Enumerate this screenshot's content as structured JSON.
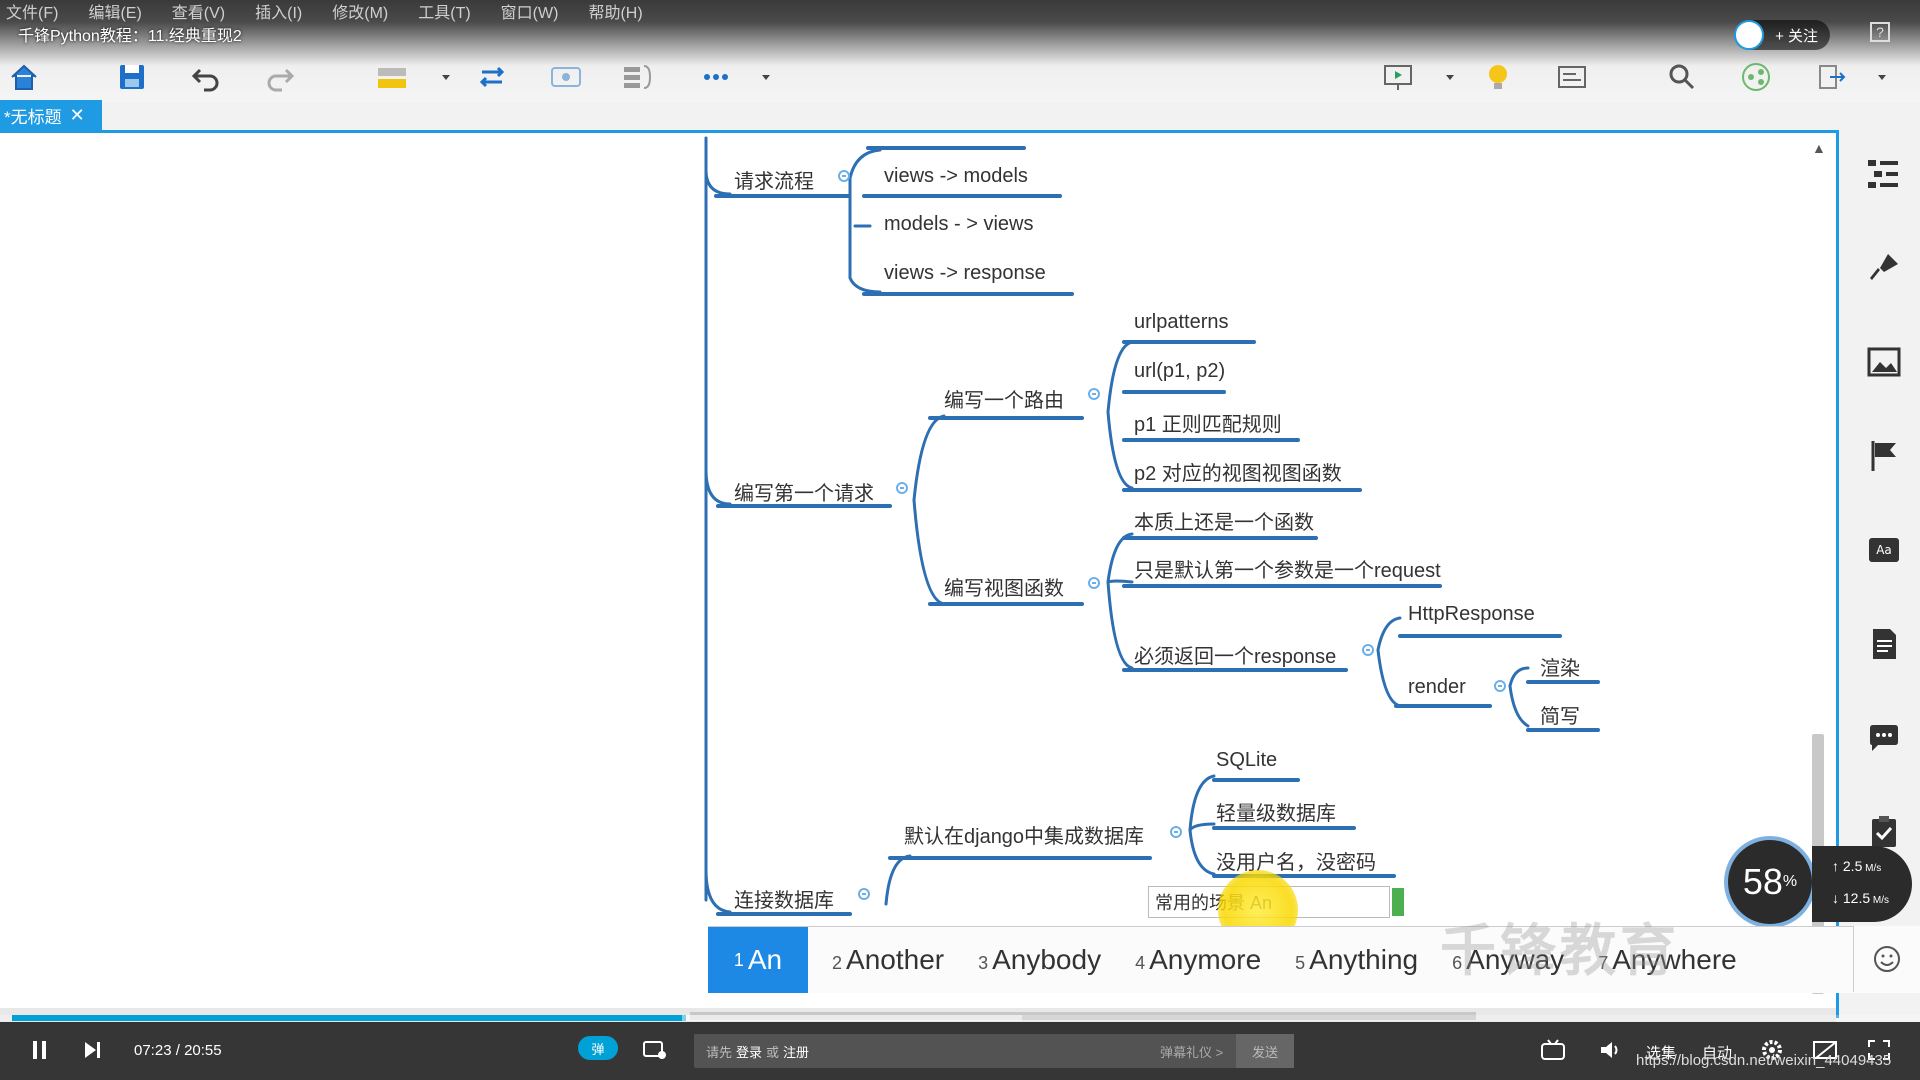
{
  "video": {
    "title": "千锋Python教程：11.经典重现2",
    "follow_label": "+ 关注",
    "current_time": "07:23",
    "separator": "/",
    "duration": "20:55",
    "progress": 0.353,
    "danmu_prompt_prefix": "请先",
    "danmu_login": "登录",
    "danmu_or": "或",
    "danmu_register": "注册",
    "danmu_etiquette": "弹幕礼仪 >",
    "send_label": "发送",
    "quality_label": "选集",
    "auto_label": "自动",
    "url": "https://blog.csdn.net/weixin_44049435",
    "danmu_toggle": "弹"
  },
  "menu": [
    "文件(F)",
    "编辑(E)",
    "查看(V)",
    "插入(I)",
    "修改(M)",
    "工具(T)",
    "窗口(W)",
    "帮助(H)"
  ],
  "tab": {
    "label": "*无标题",
    "close": "✕"
  },
  "mindmap": {
    "n1": "请求流程",
    "n1a": "views -> models",
    "n1b": "models - > views",
    "n1c": "views -> response",
    "n2": "编写第一个请求",
    "n2a": "编写一个路由",
    "n2a1": "urlpatterns",
    "n2a2": "url(p1, p2)",
    "n2a3": "p1 正则匹配规则",
    "n2a4": "p2 对应的视图视图函数",
    "n2b": "编写视图函数",
    "n2b1": "本质上还是一个函数",
    "n2b2": "只是默认第一个参数是一个request",
    "n2b3": "必须返回一个response",
    "n2b3a": "HttpResponse",
    "n2b3b": "render",
    "n2b3b1": "渲染",
    "n2b3b2": "简写",
    "n3": "连接数据库",
    "n3a": "默认在django中集成数据库",
    "n3a1": "SQLite",
    "n3a2": "轻量级数据库",
    "n3a3": "没用户名，没密码",
    "n3a4": "常用的场景 An"
  },
  "ime": {
    "candidates": [
      {
        "n": "1",
        "w": "An"
      },
      {
        "n": "2",
        "w": "Another"
      },
      {
        "n": "3",
        "w": "Anybody"
      },
      {
        "n": "4",
        "w": "Anymore"
      },
      {
        "n": "5",
        "w": "Anything"
      },
      {
        "n": "6",
        "w": "Anyway"
      },
      {
        "n": "7",
        "w": "Anywhere"
      }
    ]
  },
  "watermark": "千锋教育",
  "speed": {
    "percent": "58",
    "unit": "%",
    "up": "2.5",
    "down": "12.5",
    "unit_rate": "M/s"
  },
  "colors": {
    "accent": "#1e9be3",
    "branch": "#2d6fb3",
    "progress": "#00a1d6",
    "highlight": "#f9d800"
  }
}
